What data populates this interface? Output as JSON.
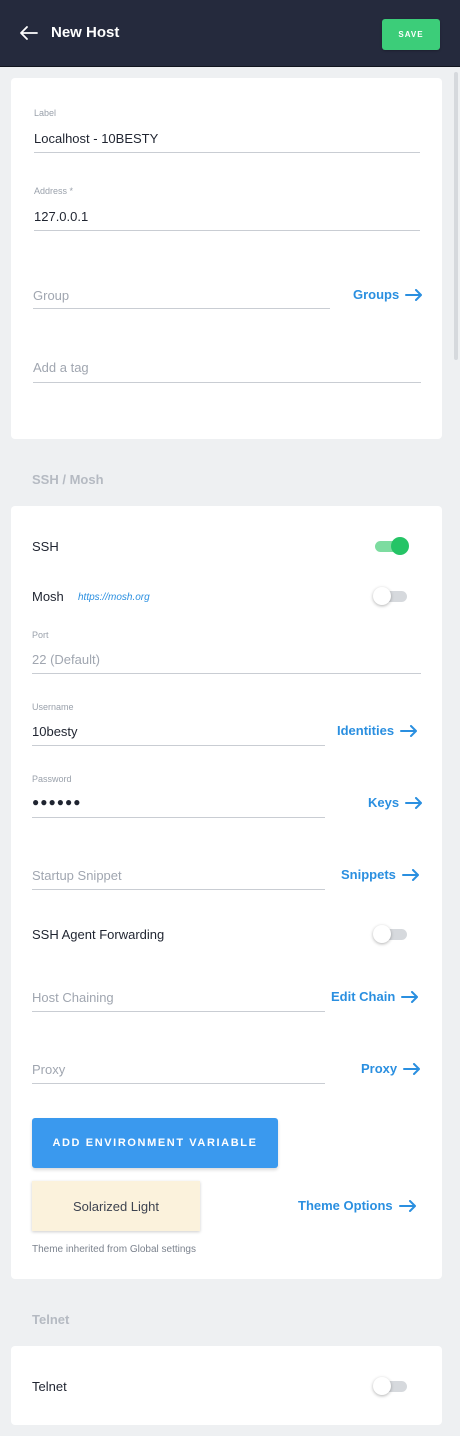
{
  "header": {
    "title": "New Host",
    "save_label": "SAVE"
  },
  "general": {
    "label_caption": "Label",
    "label_value": "Localhost - 10BESTY",
    "address_caption": "Address *",
    "address_value": "127.0.0.1",
    "group_placeholder": "Group",
    "groups_link": "Groups",
    "tag_placeholder": "Add a tag"
  },
  "ssh_section": {
    "title": "SSH / Mosh",
    "ssh_label": "SSH",
    "ssh_enabled": true,
    "mosh_label": "Mosh",
    "mosh_link": "https://mosh.org",
    "mosh_enabled": false,
    "port_caption": "Port",
    "port_placeholder": "22 (Default)",
    "username_caption": "Username",
    "username_value": "10besty",
    "identities_link": "Identities",
    "password_caption": "Password",
    "password_value": "●●●●●●",
    "keys_link": "Keys",
    "startup_placeholder": "Startup Snippet",
    "snippets_link": "Snippets",
    "agent_forwarding_label": "SSH Agent Forwarding",
    "agent_forwarding_enabled": false,
    "host_chaining_placeholder": "Host Chaining",
    "edit_chain_link": "Edit Chain",
    "proxy_placeholder": "Proxy",
    "proxy_link": "Proxy",
    "env_button": "ADD ENVIRONMENT VARIABLE",
    "theme_name": "Solarized Light",
    "theme_options_link": "Theme Options",
    "theme_note": "Theme inherited from Global settings"
  },
  "telnet_section": {
    "title": "Telnet",
    "telnet_label": "Telnet",
    "telnet_enabled": false
  },
  "colors": {
    "header_bg": "#252a3d",
    "save_green": "#3ccd79",
    "link_blue": "#2a8fe0",
    "toggle_on": "#25c466",
    "button_blue": "#3a99ee",
    "theme_swatch": "#fbf2dc"
  },
  "icons": {
    "back": "arrow-left-icon",
    "link_arrow": "arrow-right-icon"
  }
}
